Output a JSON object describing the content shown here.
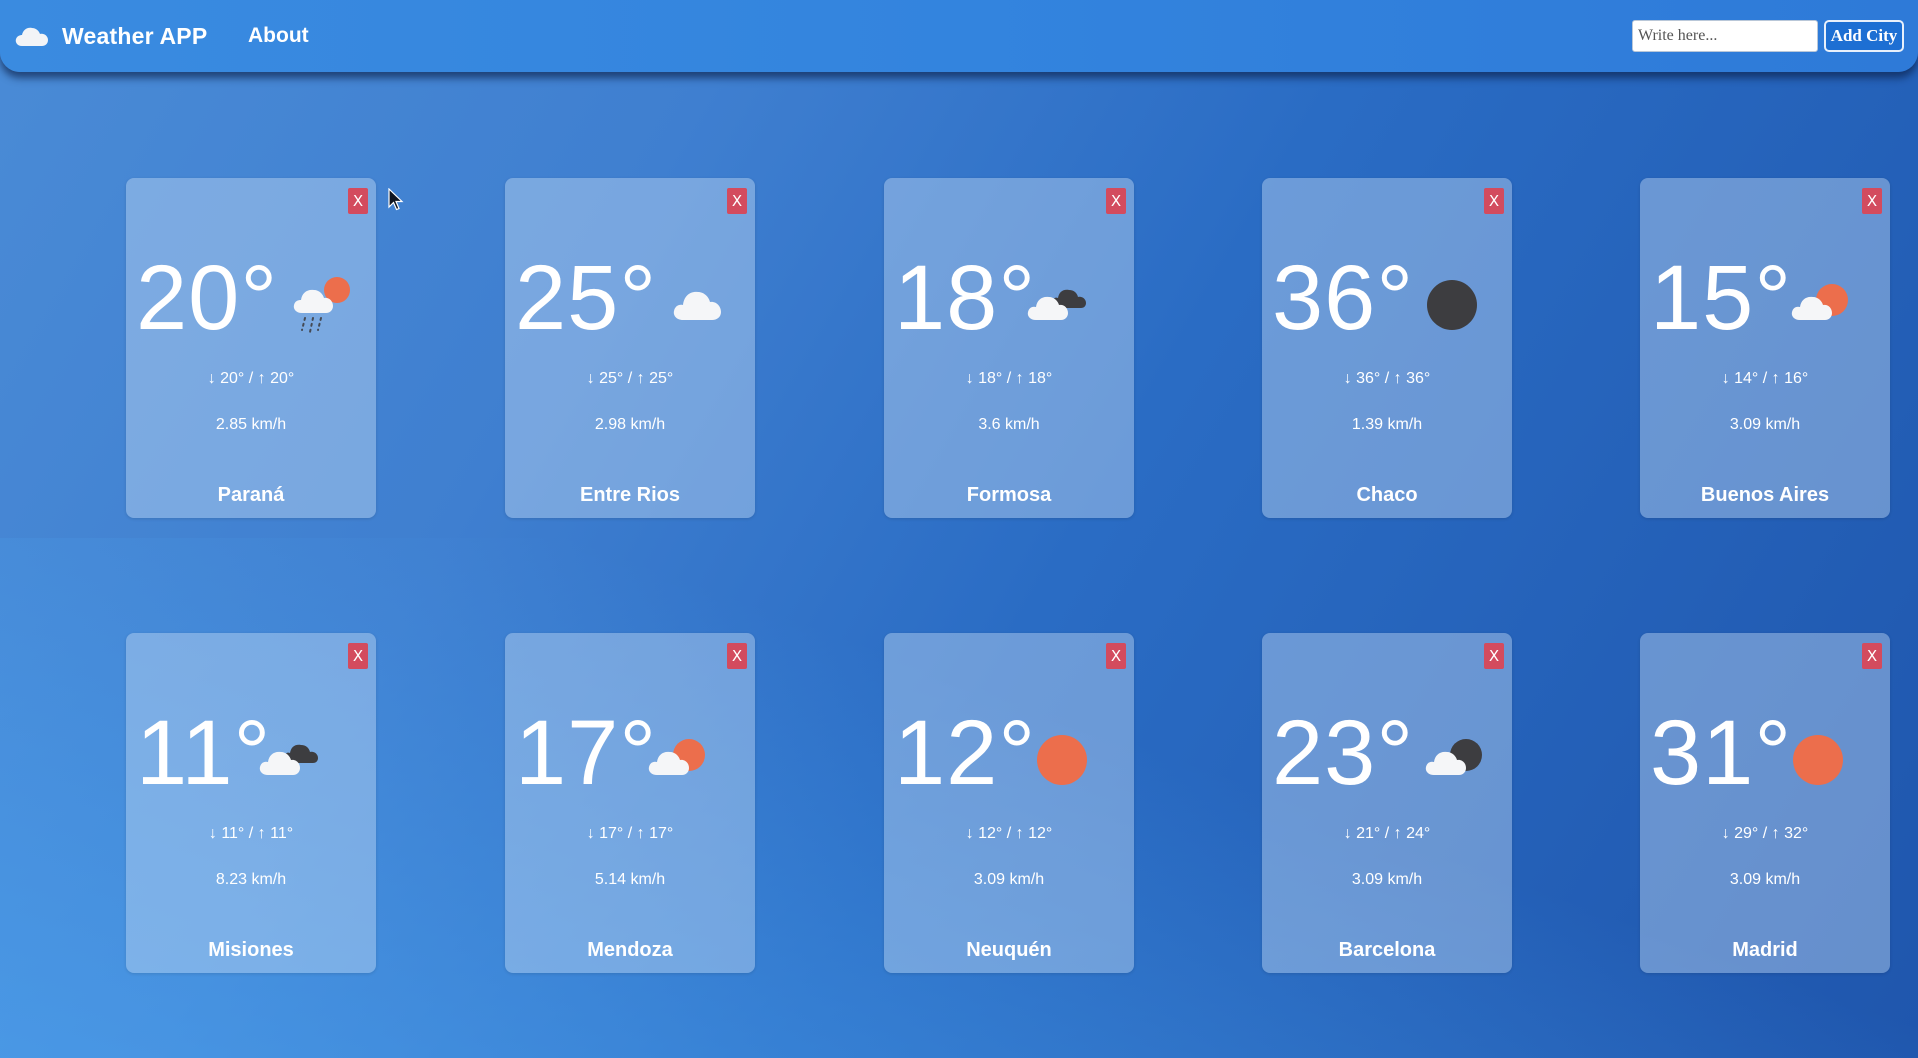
{
  "app": {
    "title": "Weather APP",
    "about_label": "About",
    "search_placeholder": "Write here...",
    "add_label": "Add City",
    "close_label": "X"
  },
  "cards": [
    {
      "temp": "20°",
      "minmax": "↓ 20° / ↑ 20°",
      "wind": "2.85 km/h",
      "city": "Paraná",
      "icon": "rain-cloud-sun-icon"
    },
    {
      "temp": "25°",
      "minmax": "↓ 25° / ↑ 25°",
      "wind": "2.98 km/h",
      "city": "Entre Rios",
      "icon": "cloud-icon"
    },
    {
      "temp": "18°",
      "minmax": "↓ 18° / ↑ 18°",
      "wind": "3.6 km/h",
      "city": "Formosa",
      "icon": "broken-clouds-icon"
    },
    {
      "temp": "36°",
      "minmax": "↓ 36° / ↑ 36°",
      "wind": "1.39 km/h",
      "city": "Chaco",
      "icon": "clear-night-icon"
    },
    {
      "temp": "15°",
      "minmax": "↓ 14° / ↑ 16°",
      "wind": "3.09 km/h",
      "city": "Buenos Aires",
      "icon": "partly-cloudy-icon"
    },
    {
      "temp": "11°",
      "minmax": "↓ 11° / ↑ 11°",
      "wind": "8.23 km/h",
      "city": "Misiones",
      "icon": "broken-clouds-icon"
    },
    {
      "temp": "17°",
      "minmax": "↓ 17° / ↑ 17°",
      "wind": "5.14 km/h",
      "city": "Mendoza",
      "icon": "partly-cloudy-icon"
    },
    {
      "temp": "12°",
      "minmax": "↓ 12° / ↑ 12°",
      "wind": "3.09 km/h",
      "city": "Neuquén",
      "icon": "sun-icon"
    },
    {
      "temp": "23°",
      "minmax": "↓ 21° / ↑ 24°",
      "wind": "3.09 km/h",
      "city": "Barcelona",
      "icon": "partly-cloudy-night-icon"
    },
    {
      "temp": "31°",
      "minmax": "↓ 29° / ↑ 32°",
      "wind": "3.09 km/h",
      "city": "Madrid",
      "icon": "sun-icon"
    }
  ],
  "colors": {
    "sun": "#ec6e4c",
    "dark": "#3d3d40",
    "cloud": "#f5f6f8",
    "close": "#d34b5e"
  }
}
